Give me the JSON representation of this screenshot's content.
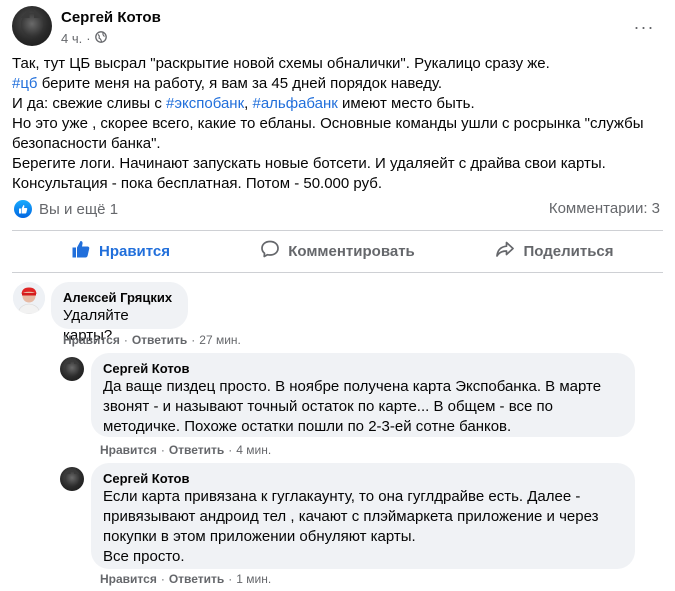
{
  "post": {
    "author": "Сергей Котов",
    "time": "4 ч.",
    "privacy_icon": "globe-icon",
    "more_icon": "more-horizontal-icon",
    "lines": {
      "l1": "Так, тут ЦБ высрал \"раскрытие новой схемы обналички\". Рукалицо сразу же.",
      "l2_tag": "#цб",
      "l2_rest": " берите меня на работу, я вам за 45 дней порядок наведу.",
      "l3_pre": "И да: свежие сливы с ",
      "l3_tag1": "#экспобанк",
      "l3_mid": ", ",
      "l3_tag2": "#альфабанк",
      "l3_rest": " имеют место быть.",
      "l4": "Но это уже , скорее всего, какие то ебланы. Основные команды ушли с росрынка \"службы безопасности банка\".",
      "l5": "Берегите логи. Начинают запускать новые ботсети. И удаляейт с драйва свои карты.",
      "l6": "Консультация - пока бесплатная. Потом - 50.000 руб."
    },
    "reactions_text": "Вы и ещё 1",
    "comments_count": "Комментарии: 3"
  },
  "actions": {
    "like": "Нравится",
    "comment": "Комментировать",
    "share": "Поделиться"
  },
  "comments": [
    {
      "author": "Алексей Гряцких",
      "text": "Удаляйте карты?",
      "like": "Нравится",
      "reply": "Ответить",
      "time": "27 мин."
    },
    {
      "author": "Сергей Котов",
      "text": "Да ваще пиздец просто. В ноябре получена карта Экспобанка. В марте звонят - и называют точный остаток по карте... В общем - все по методичке. Похоже остатки пошли по 2-3-ей сотне банков.",
      "like": "Нравится",
      "reply": "Ответить",
      "time": "4 мин."
    },
    {
      "author": "Сергей Котов",
      "text": "Если карта привязана к гуглакаунту, то она гуглдрайве есть. Далее - привязывают андроид тел , качают с плэймаркета приложение и через покупки в этом приложении обнуляют карты.",
      "text2": "Все просто.",
      "like": "Нравится",
      "reply": "Ответить",
      "time": "1 мин."
    }
  ],
  "colors": {
    "accent": "#216fdb",
    "secondary_text": "#65676b",
    "bubble_bg": "#f0f2f5",
    "divider": "#ced0d4"
  }
}
